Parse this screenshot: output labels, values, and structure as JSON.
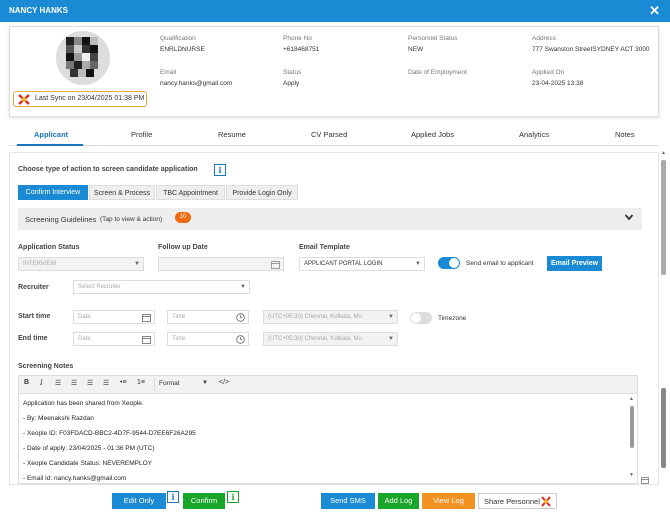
{
  "window": {
    "title": "NANCY HANKS",
    "close_glyph": "✕"
  },
  "profile": {
    "last_sync": "Last Sync on 23/04/2025 01:38 PM",
    "fields": [
      {
        "label": "Qualification",
        "value": "ENRLDNURSE"
      },
      {
        "label": "Phone No",
        "value": "+618468751"
      },
      {
        "label": "Personnel Status",
        "value": "NEW"
      },
      {
        "label": "Address",
        "value": "777 Swanston StreetSYDNEY ACT 3000"
      },
      {
        "label": "Email",
        "value": "nancy.hanks@gmail.com"
      },
      {
        "label": "Status",
        "value": "Apply"
      },
      {
        "label": "Date of Employment",
        "value": ""
      },
      {
        "label": "Applied On",
        "value": "23-04-2025 13:38"
      }
    ]
  },
  "tabs": [
    "Applicant",
    "Profile",
    "Resume",
    "CV Parsed",
    "Applied Jobs",
    "Analytics",
    "Notes"
  ],
  "screen": {
    "heading": "Choose type of action to screen candidate application",
    "actions": [
      "Confirm Interview",
      "Screen & Process",
      "TBC Appointment",
      "Provide Login Only"
    ],
    "guidelines_title": "Screening Guidelines",
    "guidelines_hint": "(Tap to view & action)",
    "guidelines_count": "10"
  },
  "form": {
    "application_status_label": "Application Status",
    "application_status_value": "INTERVIEW",
    "follow_up_label": "Follow up Date",
    "email_template_label": "Email Template",
    "email_template_value": "APPLICANT PORTAL LOGIN",
    "send_email_label": "Send email to applicant",
    "email_preview_label": "Email Preview",
    "recruiter_label": "Recruiter",
    "recruiter_placeholder": "Select Recruiter",
    "start_time_label": "Start time",
    "end_time_label": "End time",
    "date_placeholder": "Date",
    "time_placeholder": "Time",
    "timezone_value": "(UTC+05:30) Chennai, Kolkata, Mu",
    "timezone_label": "Timezone"
  },
  "notes": {
    "label": "Screening Notes",
    "format_label": "Format",
    "code_label": "</>",
    "lines": [
      "Application has been shared from Xeople.",
      "- By: Meenakshi Razdan",
      "- Xeople ID: F03FDACD-BBC2-4D7F-9544-D7EE6F26A295",
      "- Date of apply: 23/04/2025 - 01:36 PM (UTC)",
      "- Xeople Candidate Status: NEVEREMPLOY",
      "- Email Id: nancy.hanks@gmail.com"
    ]
  },
  "footer": {
    "edit_only": "Edit Only",
    "confirm": "Confirm",
    "send_sms": "Send SMS",
    "add_log": "Add Log",
    "view_log": "View Log",
    "share_personnel": "Share Personnel"
  },
  "colors": {
    "primary": "#1a8ad4",
    "green": "#17a52a",
    "orange": "#f39220",
    "badge": "#f06a0f"
  }
}
